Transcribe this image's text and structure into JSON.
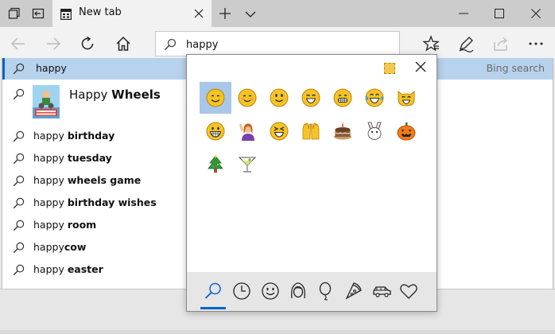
{
  "tab": {
    "title": "New tab"
  },
  "address_bar": {
    "value": "happy"
  },
  "suggestions": {
    "top": {
      "query": "happy",
      "provider": "Bing search"
    },
    "rich": {
      "prefix": "Happy ",
      "bold": "Wheels",
      "thumbnail_alt": "HAPPY WHEELS"
    },
    "items": [
      {
        "prefix": "happy ",
        "bold": "birthday"
      },
      {
        "prefix": "happy ",
        "bold": "tuesday"
      },
      {
        "prefix": "happy ",
        "bold": "wheels game"
      },
      {
        "prefix": "happy ",
        "bold": "birthday wishes"
      },
      {
        "prefix": "happy ",
        "bold": "room"
      },
      {
        "prefix": "happy",
        "bold": "cow"
      },
      {
        "prefix": "happy ",
        "bold": "easter"
      }
    ]
  },
  "emoji_panel": {
    "emojis": [
      "smiling-face",
      "smiling-face-blush",
      "slightly-smiling-face",
      "smiling-face-closed-eyes",
      "grinning-face",
      "face-tears-of-joy",
      "cat-grinning",
      "grinning-teeth",
      "woman-raising-hand",
      "squinting-face",
      "raising-hands",
      "birthday-cake",
      "rabbit",
      "jack-o-lantern",
      "christmas-tree",
      "cocktail-glass"
    ],
    "selected_index": 0,
    "categories": [
      "search",
      "recent",
      "smiley",
      "people",
      "celebration",
      "food",
      "travel",
      "heart"
    ],
    "active_category": "search"
  },
  "colors": {
    "accent": "#0a64c8",
    "highlight": "#b7d2ec",
    "emoji_yellow": "#f7c325"
  }
}
